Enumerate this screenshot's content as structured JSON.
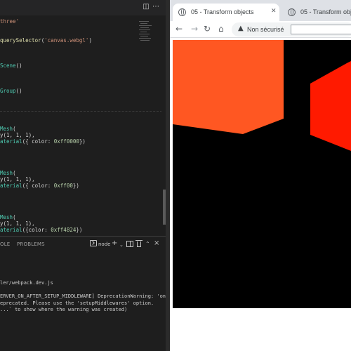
{
  "editor": {
    "code_lines": [
      {
        "parts": [
          {
            "t": "three'",
            "c": "tok-str"
          }
        ]
      },
      {
        "parts": []
      },
      {
        "parts": []
      },
      {
        "parts": [
          {
            "t": "querySelector",
            "c": "tok-fn"
          },
          {
            "t": "(",
            "c": "tok-plain"
          },
          {
            "t": "'canvas.webgl'",
            "c": "tok-str"
          },
          {
            "t": ")",
            "c": "tok-plain"
          }
        ]
      },
      {
        "parts": []
      },
      {
        "parts": []
      },
      {
        "parts": []
      },
      {
        "parts": [
          {
            "t": "Scene",
            "c": "tok-cls"
          },
          {
            "t": "()",
            "c": "tok-plain"
          }
        ]
      },
      {
        "parts": []
      },
      {
        "parts": []
      },
      {
        "parts": []
      },
      {
        "parts": [
          {
            "t": "Group",
            "c": "tok-cls"
          },
          {
            "t": "()",
            "c": "tok-plain"
          }
        ]
      },
      {
        "parts": []
      },
      {
        "parts": []
      },
      {
        "parts": []
      },
      {
        "parts": []
      },
      {
        "parts": []
      },
      {
        "parts": [
          {
            "t": "Mesh",
            "c": "tok-cls"
          },
          {
            "t": "(",
            "c": "tok-plain"
          }
        ]
      },
      {
        "parts": [
          {
            "t": "y(1, 1, 1),",
            "c": "tok-plain"
          }
        ]
      },
      {
        "parts": [
          {
            "t": "aterial",
            "c": "tok-cls"
          },
          {
            "t": "({ color: ",
            "c": "tok-plain"
          },
          {
            "t": "0xff0000",
            "c": "tok-num"
          },
          {
            "t": "})",
            "c": "tok-plain"
          }
        ]
      },
      {
        "parts": []
      },
      {
        "parts": []
      },
      {
        "parts": []
      },
      {
        "parts": []
      },
      {
        "parts": [
          {
            "t": "Mesh",
            "c": "tok-cls"
          },
          {
            "t": "(",
            "c": "tok-plain"
          }
        ]
      },
      {
        "parts": [
          {
            "t": "y(1, 1, 1),",
            "c": "tok-plain"
          }
        ]
      },
      {
        "parts": [
          {
            "t": "aterial",
            "c": "tok-cls"
          },
          {
            "t": "({ color: ",
            "c": "tok-plain"
          },
          {
            "t": "0xff00",
            "c": "tok-num"
          },
          {
            "t": "})",
            "c": "tok-plain"
          }
        ]
      },
      {
        "parts": []
      },
      {
        "parts": []
      },
      {
        "parts": []
      },
      {
        "parts": []
      },
      {
        "parts": [
          {
            "t": "Mesh",
            "c": "tok-cls"
          },
          {
            "t": "(",
            "c": "tok-plain"
          }
        ]
      },
      {
        "parts": [
          {
            "t": "y(1, 1, 1),",
            "c": "tok-plain"
          }
        ]
      },
      {
        "parts": [
          {
            "t": "aterial",
            "c": "tok-cls"
          },
          {
            "t": "({color: ",
            "c": "tok-plain"
          },
          {
            "t": "0xff4824",
            "c": "tok-num"
          },
          {
            "t": "})",
            "c": "tok-plain"
          }
        ]
      }
    ]
  },
  "panel": {
    "tab_console": "OLE",
    "tab_problems": "PROBLEMS",
    "terminal_name": "node",
    "output_lines": [
      "",
      "",
      "",
      "",
      "ler/webpack.dev.js",
      "",
      "ERVER_ON_AFTER_SETUP_MIDDLEWARE] DeprecationWarning: 'onAf",
      "eprecated. Please use the 'setupMiddlewares' option.",
      "...` to show where the warning was created)"
    ]
  },
  "browser": {
    "tabs": [
      {
        "title": "05 - Transform objects"
      },
      {
        "title": "05 - Transform objects"
      }
    ],
    "security_label": "Non sécurisé",
    "url_value": ""
  },
  "scene": {
    "background": "#000000",
    "objects": [
      {
        "name": "orange-cube",
        "color": "#ff5722"
      },
      {
        "name": "red-cube",
        "color": "#ff1a00"
      }
    ]
  }
}
